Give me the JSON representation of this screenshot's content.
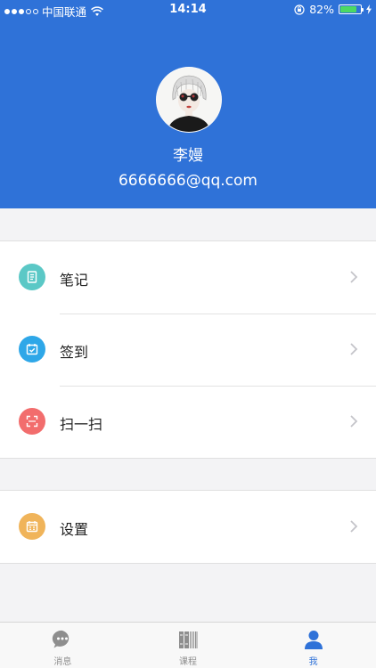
{
  "status_bar": {
    "carrier": "中国联通",
    "time": "14:14",
    "battery": "82%",
    "battery_level": 0.82
  },
  "profile": {
    "name": "李嫚",
    "email": "6666666@qq.com"
  },
  "menu": {
    "items": [
      {
        "label": "笔记",
        "icon": "notes-icon",
        "color": "#5bc8c6"
      },
      {
        "label": "签到",
        "icon": "calendar-check-icon",
        "color": "#2ea7e8"
      },
      {
        "label": "扫一扫",
        "icon": "scan-icon",
        "color": "#f26d6d"
      }
    ],
    "settings": {
      "label": "设置",
      "icon": "settings-calendar-icon",
      "color": "#f0b45a"
    }
  },
  "tabbar": {
    "tabs": [
      {
        "label": "消息",
        "icon": "message-icon"
      },
      {
        "label": "课程",
        "icon": "books-icon"
      },
      {
        "label": "我",
        "icon": "person-icon"
      }
    ],
    "active_index": 2,
    "active_color": "#2f72d8"
  },
  "colors": {
    "header": "#2f72d8",
    "background": "#f3f3f5"
  }
}
